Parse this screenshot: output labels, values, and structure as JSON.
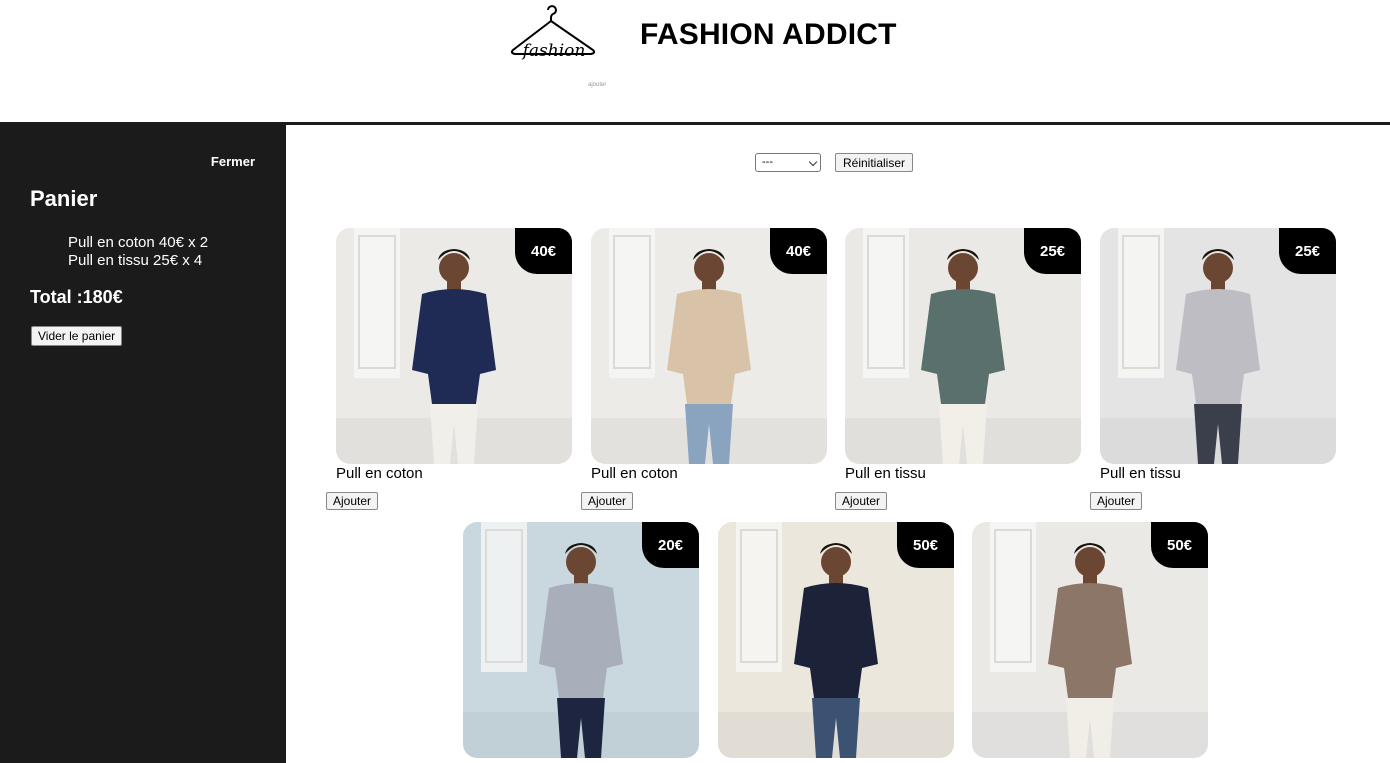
{
  "header": {
    "brand": "FASHION ADDICT",
    "logo_text": "fashion",
    "logo_caption": "ajouter"
  },
  "sidebar": {
    "close_label": "Fermer",
    "title": "Panier",
    "items": [
      "Pull en coton 40€ x 2",
      "Pull en tissu 25€ x 4"
    ],
    "total": "Total :180€",
    "empty_label": "Vider le panier"
  },
  "filter": {
    "selected": "---",
    "reset_label": "Réinitialiser"
  },
  "products": [
    {
      "name": "Pull en coton",
      "price": "40€",
      "add_label": "Ajouter",
      "bg": "#eceae6",
      "top": "#1f2a55",
      "bottom": "#f0efe9"
    },
    {
      "name": "Pull en coton",
      "price": "40€",
      "add_label": "Ajouter",
      "bg": "#ecebe7",
      "top": "#d8c3a8",
      "bottom": "#8aa3bf"
    },
    {
      "name": "Pull en tissu",
      "price": "25€",
      "add_label": "Ajouter",
      "bg": "#ebe9e5",
      "top": "#5a706c",
      "bottom": "#f1efe8"
    },
    {
      "name": "Pull en tissu",
      "price": "25€",
      "add_label": "Ajouter",
      "bg": "#e4e4e4",
      "top": "#bdbdc3",
      "bottom": "#3b3f4c"
    },
    {
      "name": "",
      "price": "20€",
      "add_label": "",
      "bg": "#c9d8df",
      "top": "#a9aebb",
      "bottom": "#1e2540"
    },
    {
      "name": "",
      "price": "50€",
      "add_label": "",
      "bg": "#ece7dd",
      "top": "#1c2238",
      "bottom": "#3c5272"
    },
    {
      "name": "",
      "price": "50€",
      "add_label": "",
      "bg": "#ebe9e6",
      "top": "#8b7668",
      "bottom": "#f0eee6"
    }
  ]
}
